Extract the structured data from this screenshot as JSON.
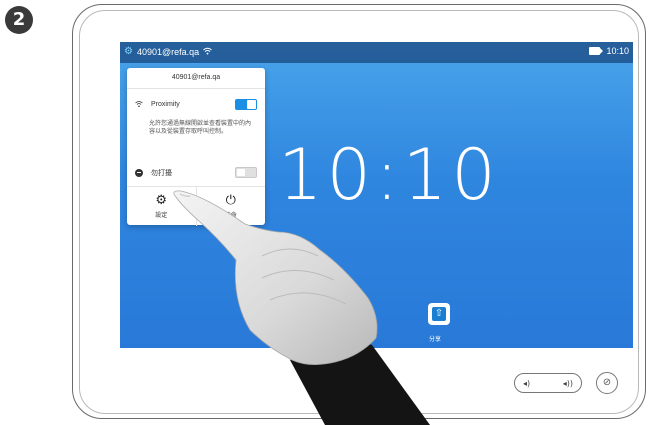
{
  "step": {
    "number": "2"
  },
  "status_bar": {
    "settings_icon": "gear-icon",
    "address": "40901@refa.qa",
    "proximity_icon": "wifi-icon",
    "camera_icon": "camera-icon",
    "time": "10:10"
  },
  "clock": {
    "time": "10:10"
  },
  "panel": {
    "title": "40901@refa.qa",
    "proximity": {
      "label": "Proximity",
      "enabled": true,
      "icon": "proximity-icon"
    },
    "proximity_description": "允許您通過無線開啟並查看裝置中的內容以及從裝置存取呼叫控制。",
    "dnd": {
      "label": "勿打擾",
      "enabled": false,
      "icon": "do-not-disturb-icon"
    },
    "settings_button": {
      "label": "設定",
      "icon": "gear-icon"
    },
    "standby_button": {
      "label": "待命",
      "icon": "power-icon"
    }
  },
  "share": {
    "label": "分享",
    "icon": "share-icon"
  },
  "volume": {
    "minus_icon": "volume-down-icon",
    "plus_icon": "volume-up-icon"
  },
  "mute": {
    "icon": "mic-mute-icon"
  },
  "colors": {
    "accent": "#1a8fe3",
    "screen_top": "#4aa4ea",
    "screen_bottom": "#2979d8"
  }
}
